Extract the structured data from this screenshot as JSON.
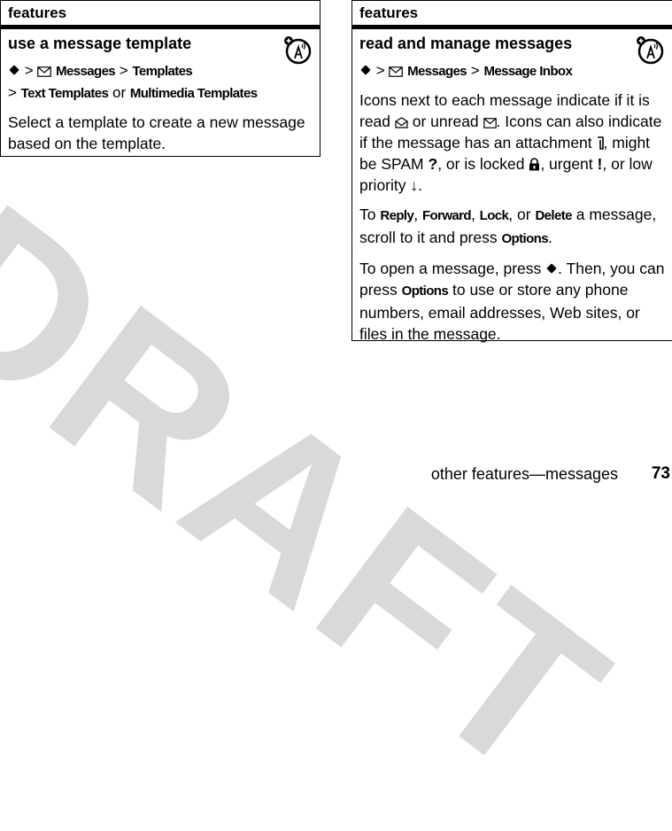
{
  "watermark": "DRAFT",
  "left_box": {
    "header": "features",
    "title": "use a message template",
    "path": {
      "sep1": ">",
      "messages": "Messages",
      "sep2": ">",
      "templates": "Templates",
      "sep3": ">",
      "text_templates": "Text Templates",
      "or": "or",
      "multimedia_templates": "Multimedia Templates"
    },
    "description": "Select a template to create a new message based on the template."
  },
  "right_box": {
    "header": "features",
    "title": "read and manage messages",
    "path": {
      "sep1": ">",
      "messages": "Messages",
      "sep2": ">",
      "inbox": "Message Inbox"
    },
    "icons_para": {
      "t1": "Icons next to each message indicate if it is read ",
      "t2": " or unread ",
      "t3": ". Icons can also indicate if the message has an attachment ",
      "t4": ", might be SPAM ",
      "spam_glyph": "?",
      "t5": ", or is locked ",
      "t6": ", urgent ",
      "urgent_glyph": "!",
      "t7": ", or low priority ",
      "low_glyph": "↓",
      "t8": "."
    },
    "actions_para": {
      "t1": "To ",
      "reply": "Reply",
      "c1": ", ",
      "forward": "Forward",
      "c2": ", ",
      "lock": "Lock",
      "c3": ", or ",
      "delete": "Delete",
      "t2": " a message, scroll to it and press ",
      "options": "Options",
      "t3": "."
    },
    "open_para": {
      "t1": "To open a message, press ",
      "t2": ". Then, you can press ",
      "options": "Options",
      "t3": " to use or store any phone numbers, email addresses, Web sites, or files in the message."
    }
  },
  "footer": {
    "section": "other features—messages",
    "page_number": "73"
  }
}
